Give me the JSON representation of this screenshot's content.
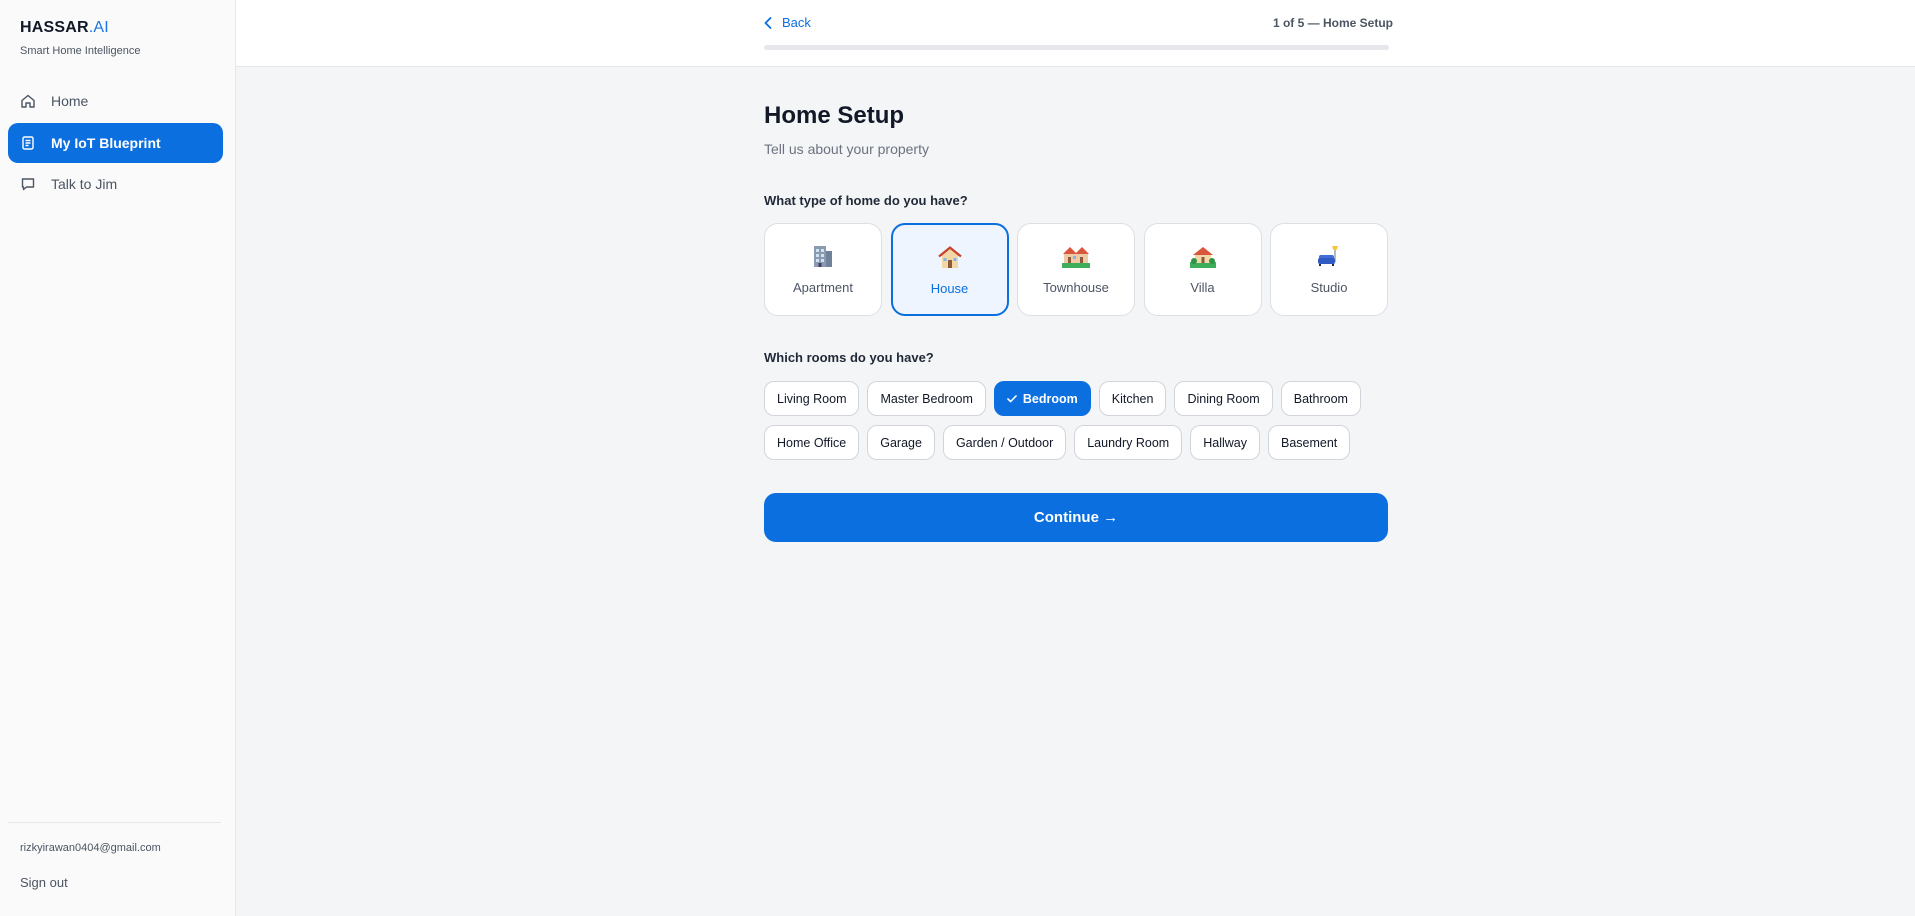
{
  "brand": {
    "name": "HASSAR",
    "suffix": ".AI",
    "tagline": "Smart Home Intelligence"
  },
  "sidebar": {
    "items": [
      {
        "label": "Home",
        "icon": "home-icon",
        "active": false
      },
      {
        "label": "My IoT Blueprint",
        "icon": "document-icon",
        "active": true
      },
      {
        "label": "Talk to Jim",
        "icon": "chat-icon",
        "active": false
      }
    ],
    "user_email": "rizkyirawan0404@gmail.com",
    "sign_out": "Sign out"
  },
  "topbar": {
    "back_label": "Back",
    "step_label": "1 of 5 — Home Setup",
    "progress": 0
  },
  "page": {
    "title": "Home Setup",
    "subtitle": "Tell us about your property",
    "home_type_question": "What type of home do you have?",
    "home_types": [
      {
        "label": "Apartment",
        "icon": "apartment-building-icon",
        "selected": false
      },
      {
        "label": "House",
        "icon": "house-icon",
        "selected": true
      },
      {
        "label": "Townhouse",
        "icon": "townhouse-icon",
        "selected": false
      },
      {
        "label": "Villa",
        "icon": "villa-icon",
        "selected": false
      },
      {
        "label": "Studio",
        "icon": "studio-couch-icon",
        "selected": false
      }
    ],
    "rooms_question": "Which rooms do you have?",
    "rooms": [
      [
        "Living Room",
        "Master Bedroom",
        "Bedroom",
        "Kitchen",
        "Dining Room",
        "Bathroom"
      ],
      [
        "Home Office",
        "Garage",
        "Garden / Outdoor",
        "Laundry Room",
        "Hallway",
        "Basement"
      ]
    ],
    "selected_rooms": [
      "Bedroom"
    ],
    "continue_label": "Continue →"
  },
  "colors": {
    "accent": "#0b6fe0",
    "background": "#f4f5f7",
    "sidebar": "#fafafa"
  }
}
